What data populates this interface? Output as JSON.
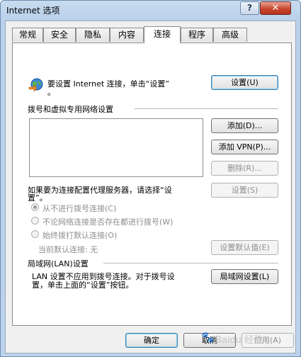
{
  "window": {
    "title": "Internet 选项",
    "help_glyph": "?",
    "close_glyph": "✕"
  },
  "tabs": [
    {
      "label": "常规",
      "active": false
    },
    {
      "label": "安全",
      "active": false
    },
    {
      "label": "隐私",
      "active": false
    },
    {
      "label": "内容",
      "active": false
    },
    {
      "label": "连接",
      "active": true
    },
    {
      "label": "程序",
      "active": false
    },
    {
      "label": "高级",
      "active": false
    }
  ],
  "setup": {
    "icon": "globe-connect-icon",
    "text_line1": "要设置 Internet 连接，单击“设置”",
    "text_line2": "。",
    "button": "设置(U)"
  },
  "dialup": {
    "heading": "拨号和虚拟专用网络设置",
    "connections": [],
    "add_button": "添加(D)...",
    "add_vpn_button": "添加 VPN(P)...",
    "remove_button": "删除(R)...",
    "proxy_text_line1": "如果要为连接配置代理服务器，请选择“设",
    "proxy_text_line2": "置”。",
    "settings_button": "设置(S)",
    "radio_options": [
      {
        "label": "从不进行拨号连接(C)",
        "checked": true
      },
      {
        "label": "不论网络连接是否存在都进行拨号(W)",
        "checked": false
      },
      {
        "label": "始终拨打默认连接(O)",
        "checked": false
      }
    ],
    "current_default_label": "当前默认连接: 无",
    "set_default_button": "设置默认值(E)"
  },
  "lan": {
    "heading": "局域网(LAN)设置",
    "text_line1": "LAN 设置不应用到拨号连接。对于拨号设",
    "text_line2": "置，单击上面的“设置”按钮。",
    "button": "局域网设置(L)"
  },
  "footer": {
    "ok_button": "确定",
    "cancel_button": "取消",
    "apply_button": "应用(A)",
    "watermark_text": "Baidu 经验"
  }
}
